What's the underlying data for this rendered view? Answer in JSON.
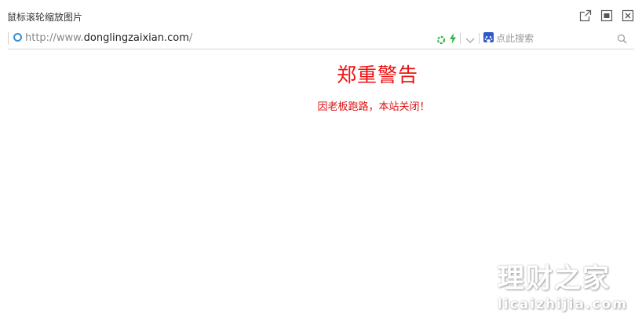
{
  "window": {
    "title": "鼠标滚轮缩放图片",
    "buttons": [
      "popout-icon",
      "maximize-icon",
      "close-icon"
    ]
  },
  "address_bar": {
    "url_prefix": "http://www.",
    "url_domain": "donglingzaixian.com",
    "url_suffix": "/",
    "search_placeholder": "点此搜索",
    "icons": [
      "globe-icon",
      "refresh-icon",
      "bolt-icon",
      "chevron-down-icon",
      "paw-icon",
      "search-icon"
    ]
  },
  "page": {
    "title": "郑重警告",
    "message": "因老板跑路，本站关闭！"
  },
  "watermark": {
    "cn": "理财之家",
    "en": "licaizhijia.com"
  },
  "colors": {
    "warning_red": "#ee1111",
    "link_blue": "#3b8ed6",
    "refresh_green": "#3bb54a",
    "baidu_blue": "#2f58c8"
  }
}
